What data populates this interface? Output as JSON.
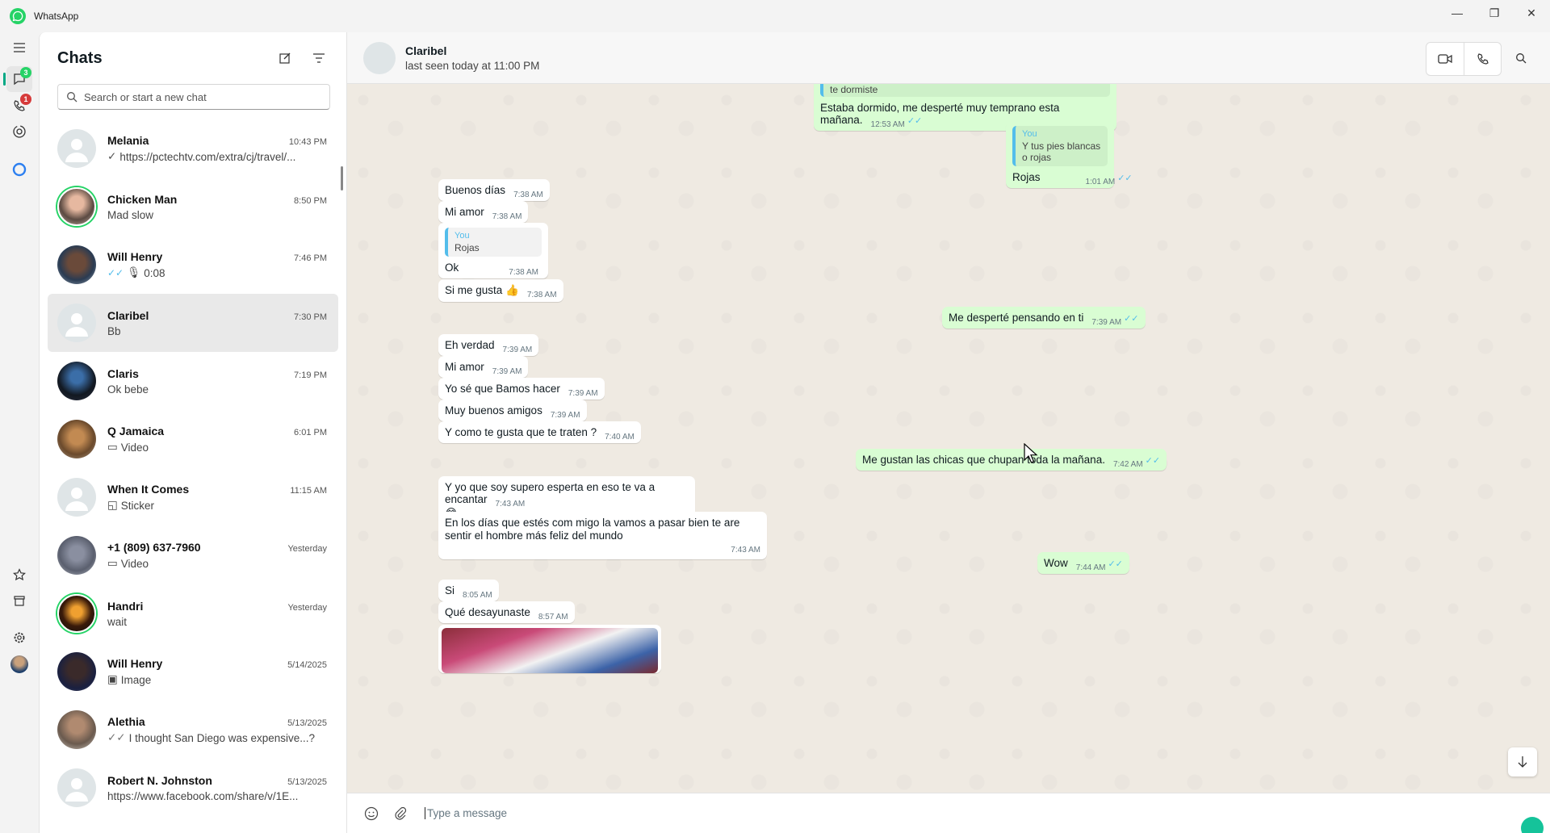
{
  "app": {
    "title": "WhatsApp"
  },
  "rail": {
    "chats_badge": "3",
    "calls_badge": "1"
  },
  "chatlist": {
    "title": "Chats",
    "search_placeholder": "Search or start a new chat",
    "items": [
      {
        "name": "Melania",
        "time": "10:43 PM",
        "tick": "✓",
        "preview": "https://pctechtv.com/extra/cj/travel/..."
      },
      {
        "name": "Chicken Man",
        "time": "8:50 PM",
        "tick": "",
        "preview": "Mad slow"
      },
      {
        "name": "Will Henry",
        "time": "7:46 PM",
        "tick": "✓✓",
        "preview": "0:08"
      },
      {
        "name": "Claribel",
        "time": "7:30 PM",
        "tick": "",
        "preview": "Bb"
      },
      {
        "name": "Claris",
        "time": "7:19 PM",
        "tick": "",
        "preview": "Ok bebe"
      },
      {
        "name": "Q Jamaica",
        "time": "6:01 PM",
        "tick": "",
        "preview": "Video"
      },
      {
        "name": "When It Comes",
        "time": "11:15 AM",
        "tick": "",
        "preview": "Sticker"
      },
      {
        "name": "+1 (809) 637-7960",
        "time": "Yesterday",
        "tick": "",
        "preview": "Video"
      },
      {
        "name": "Handri",
        "time": "Yesterday",
        "tick": "",
        "preview": "wait"
      },
      {
        "name": "Will Henry",
        "time": "5/14/2025",
        "tick": "",
        "preview": "Image"
      },
      {
        "name": "Alethia",
        "time": "5/13/2025",
        "tick": "✓✓",
        "preview": "I thought San Diego was expensive...?"
      },
      {
        "name": "Robert N. Johnston",
        "time": "5/13/2025",
        "tick": "",
        "preview": "https://www.facebook.com/share/v/1E..."
      }
    ]
  },
  "conversation": {
    "name": "Claribel",
    "status": "last seen today at 11:00 PM",
    "messages": {
      "m0_text": "te dormiste",
      "m1_text": "Estaba dormido, me desperté muy temprano esta mañana.",
      "m1_time": "12:53 AM",
      "m2_qname": "You",
      "m2_qtext": "Y tus pies blancas o rojas",
      "m2_text": "Rojas",
      "m2_time": "1:01 AM",
      "m3_text": "Buenos días",
      "m3_time": "7:38 AM",
      "m4_text": "Mi amor",
      "m4_time": "7:38 AM",
      "m5_qname": "You",
      "m5_qtext": "Rojas",
      "m5_text": "Ok",
      "m5_time": "7:38 AM",
      "m6_text": "Si me gusta 👍",
      "m6_time": "7:38 AM",
      "m7_text": "Me desperté pensando en ti",
      "m7_time": "7:39 AM",
      "m8_text": "Eh verdad",
      "m8_time": "7:39 AM",
      "m9_text": "Mi amor",
      "m9_time": "7:39 AM",
      "m10_text": "Yo sé que Bamos hacer",
      "m10_time": "7:39 AM",
      "m11_text": "Muy buenos amigos",
      "m11_time": "7:39 AM",
      "m12_text": "Y como te gusta que te traten ?",
      "m12_time": "7:40 AM",
      "m13_text": "Me gustan las chicas que chupan toda la mañana.",
      "m13_time": "7:42 AM",
      "m14_text": "Y yo que soy supero esperta en eso te va a encantar",
      "m14_emoji": "😂",
      "m14_time": "7:43 AM",
      "m15_text": "En los días que estés com migo la vamos a pasar bien te are sentir el hombre más feliz del mundo",
      "m15_time": "7:43 AM",
      "m16_text": "Wow",
      "m16_time": "7:44 AM",
      "m17_text": "Si",
      "m17_time": "8:05 AM",
      "m18_text": "Qué desayunaste",
      "m18_time": "8:57 AM"
    },
    "composer_placeholder": "Type a message"
  },
  "colors": {
    "accent": "#25d366",
    "outgoing": "#d9fdd3",
    "tick": "#53bdeb"
  }
}
